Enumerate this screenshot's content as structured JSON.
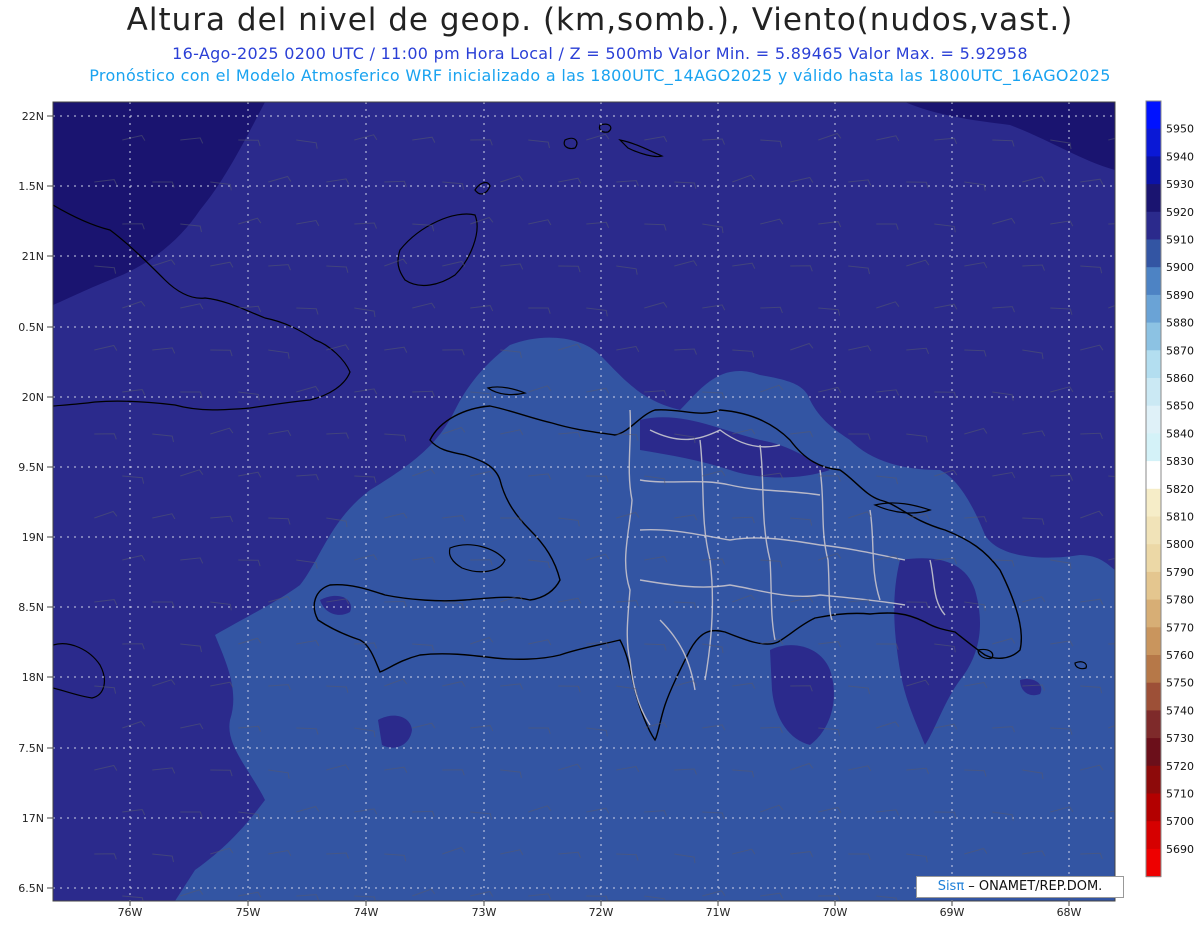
{
  "header": {
    "title": "Altura del nivel de geop. (km,somb.), Viento(nudos,vast.)",
    "subtitle": "16-Ago-2025  0200 UTC / 11:00 pm Hora Local / Z = 500mb    Valor Min. = 5.89465  Valor Max. = 5.92958",
    "subtitle2": "Pronóstico con el Modelo Atmosferico WRF inicializado a las 1800UTC_14AGO2025 y válido hasta las  1800UTC_16AGO2025"
  },
  "map": {
    "lat_labels": [
      "22N",
      "1.5N",
      "21N",
      "0.5N",
      "20N",
      "9.5N",
      "19N",
      "8.5N",
      "18N",
      "7.5N",
      "17N",
      "6.5N"
    ],
    "lon_labels": [
      "76W",
      "75W",
      "74W",
      "73W",
      "72W",
      "71W",
      "70W",
      "69W",
      "68W"
    ],
    "colors": {
      "high_5920": "#1a1470",
      "mid_5910": "#2b2a8c",
      "low_5900": "#3355a3",
      "coast": "#000000",
      "provinces": "#b8b8c8"
    }
  },
  "legend": {
    "levels": [
      "5950",
      "5940",
      "5930",
      "5920",
      "5910",
      "5900",
      "5890",
      "5880",
      "5870",
      "5860",
      "5850",
      "5840",
      "5830",
      "5820",
      "5810",
      "5800",
      "5790",
      "5780",
      "5770",
      "5760",
      "5750",
      "5740",
      "5730",
      "5720",
      "5710",
      "5700",
      "5690"
    ],
    "colors": [
      "#0012ff",
      "#0a18d6",
      "#0b12a6",
      "#1a1470",
      "#2b2a8c",
      "#3355a3",
      "#4d83c4",
      "#6aa3d6",
      "#8cc2e3",
      "#b3def0",
      "#cbe9f4",
      "#dff1f8",
      "#d4f2f8",
      "#ffffff",
      "#f6edc8",
      "#f1e3b8",
      "#ecd8a6",
      "#e4c68f",
      "#d7ae75",
      "#c9955d",
      "#b67848",
      "#9d5037",
      "#7e2a2a",
      "#6b0f1a",
      "#8d0a0a",
      "#b30000",
      "#d60000",
      "#ee0000"
    ]
  },
  "credit": {
    "brand": "Sisπ",
    "rest": " – ONAMET/REP.DOM."
  }
}
